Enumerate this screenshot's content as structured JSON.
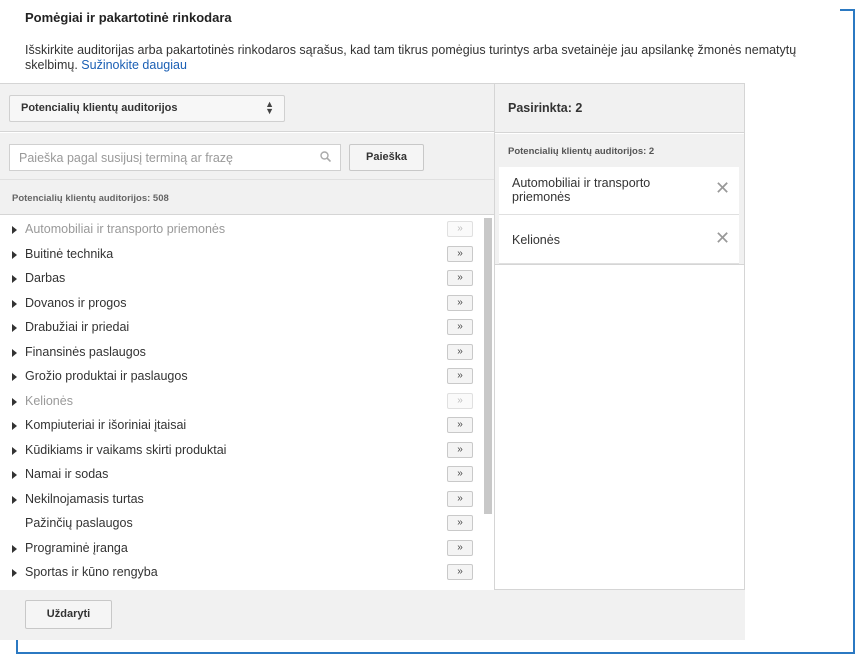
{
  "dialog": {
    "title": "Pomėgiai ir pakartotinė rinkodara",
    "description": "Išskirkite auditorijas arba pakartotinės rinkodaros sąrašus, kad tam tikrus pomėgius turintys arba svetainėje jau apsilankę žmonės nematytų skelbimų.",
    "learn_more": "Sužinokite daugiau",
    "close_label": "Uždaryti"
  },
  "left": {
    "select_value": "Potencialių klientų auditorijos",
    "search_placeholder": "Paieška pagal susijusį terminą ar frazę",
    "search_button": "Paieška",
    "count_label": "Potencialių klientų auditorijos: 508",
    "add_glyph": "»",
    "items": [
      {
        "label": "Automobiliai ir transporto priemonės",
        "expandable": true,
        "disabled": true
      },
      {
        "label": "Buitinė technika",
        "expandable": true,
        "disabled": false
      },
      {
        "label": "Darbas",
        "expandable": true,
        "disabled": false
      },
      {
        "label": "Dovanos ir progos",
        "expandable": true,
        "disabled": false
      },
      {
        "label": "Drabužiai ir priedai",
        "expandable": true,
        "disabled": false
      },
      {
        "label": "Finansinės paslaugos",
        "expandable": true,
        "disabled": false
      },
      {
        "label": "Grožio produktai ir paslaugos",
        "expandable": true,
        "disabled": false
      },
      {
        "label": "Kelionės",
        "expandable": true,
        "disabled": true
      },
      {
        "label": "Kompiuteriai ir išoriniai įtaisai",
        "expandable": true,
        "disabled": false
      },
      {
        "label": "Kūdikiams ir vaikams skirti produktai",
        "expandable": true,
        "disabled": false
      },
      {
        "label": "Namai ir sodas",
        "expandable": true,
        "disabled": false
      },
      {
        "label": "Nekilnojamasis turtas",
        "expandable": true,
        "disabled": false
      },
      {
        "label": "Pažinčių paslaugos",
        "expandable": false,
        "disabled": false
      },
      {
        "label": "Programinė įranga",
        "expandable": true,
        "disabled": false
      },
      {
        "label": "Sportas ir kūno rengyba",
        "expandable": true,
        "disabled": false
      }
    ]
  },
  "right": {
    "selected_title": "Pasirinkta: 2",
    "group_header": "Potencialių klientų auditorijos: 2",
    "remove_glyph": "✕",
    "selected": [
      {
        "label": "Automobiliai ir transporto priemonės"
      },
      {
        "label": "Kelionės"
      }
    ]
  },
  "colors": {
    "accent_link": "#1a5fb4",
    "frame": "#2b79c2",
    "panel_bg": "#f1f1f1"
  }
}
